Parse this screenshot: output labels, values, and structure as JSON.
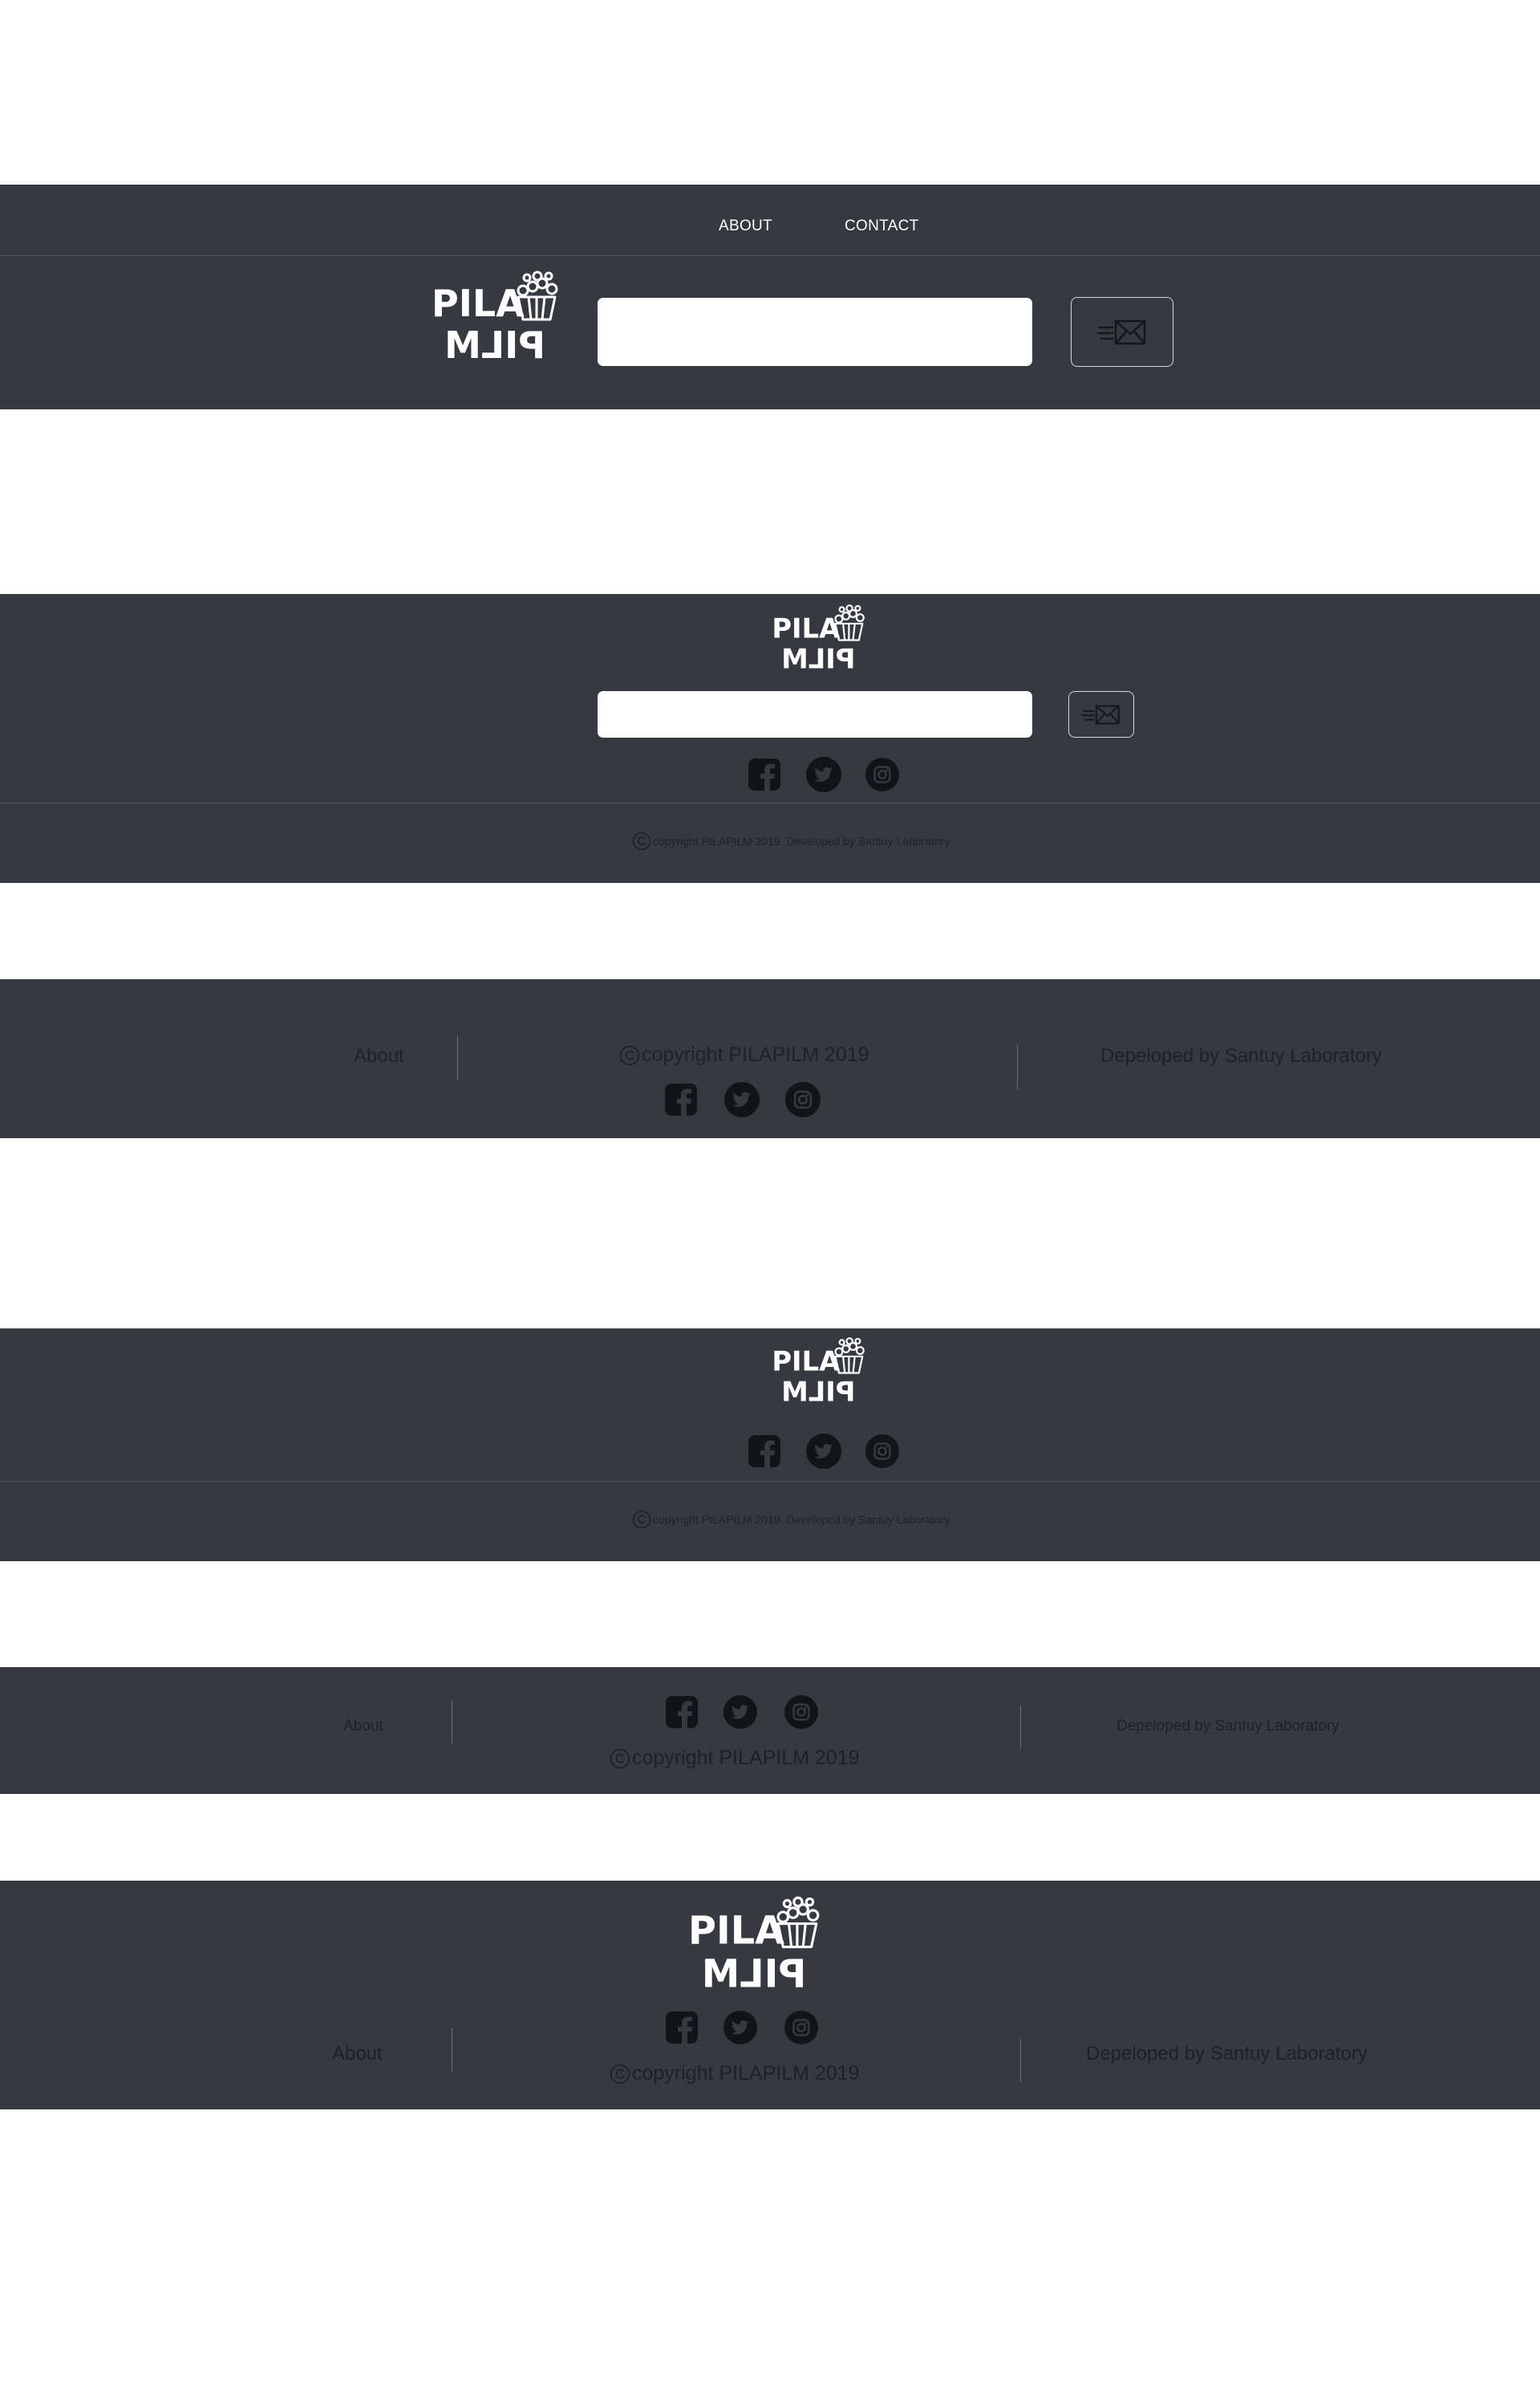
{
  "brand": {
    "line1": "PILA",
    "line2": "PILM"
  },
  "nav": {
    "about": "ABOUT",
    "contact": "CONTACT"
  },
  "footer": {
    "copyright_small": "copyright  PILAPILM 2019. Developed by Santuy Laboratory",
    "copyright": "copyright  PILAPILM 2019",
    "about": "About",
    "developer": "Depeloped by Santuy Laboratory"
  },
  "icons": {
    "send": "send-mail-icon",
    "facebook": "facebook-icon",
    "twitter": "twitter-icon",
    "instagram": "instagram-icon",
    "copyright": "copyright-icon"
  },
  "colors": {
    "band": "#363a40",
    "text_dark": "#1e2024",
    "text_light": "#ffffff",
    "field": "#ffffff"
  }
}
